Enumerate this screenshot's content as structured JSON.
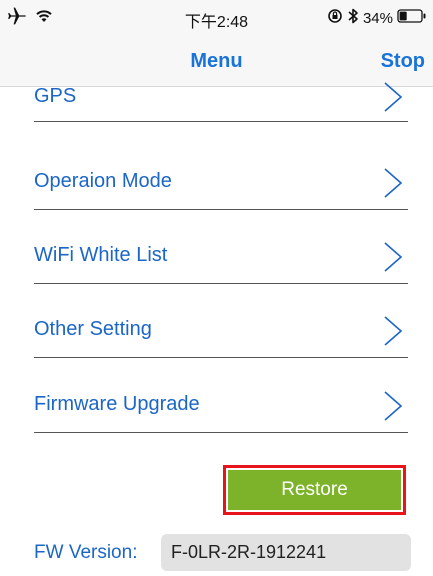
{
  "status_bar": {
    "time": "下午2:48",
    "battery_percent": "34%",
    "battery_level": 0.34,
    "icons": [
      "airplane-icon",
      "wifi-icon",
      "rotation-lock-icon",
      "bluetooth-icon",
      "battery-icon"
    ]
  },
  "nav": {
    "title": "Menu",
    "stop_label": "Stop"
  },
  "menu": {
    "items": [
      {
        "label": "GPS"
      },
      {
        "label": "Operaion Mode"
      },
      {
        "label": "WiFi White List"
      },
      {
        "label": "Other Setting"
      },
      {
        "label": "Firmware Upgrade"
      }
    ],
    "chevron_icon": "chevron-right-icon"
  },
  "restore": {
    "label": "Restore"
  },
  "firmware": {
    "label": "FW Version:",
    "value": "F-0LR-2R-1912241"
  },
  "colors": {
    "accent": "#1a73d9",
    "label_text": "#1b66c6",
    "restore_bg": "#7cb32a",
    "highlight_border": "#e8141b"
  }
}
